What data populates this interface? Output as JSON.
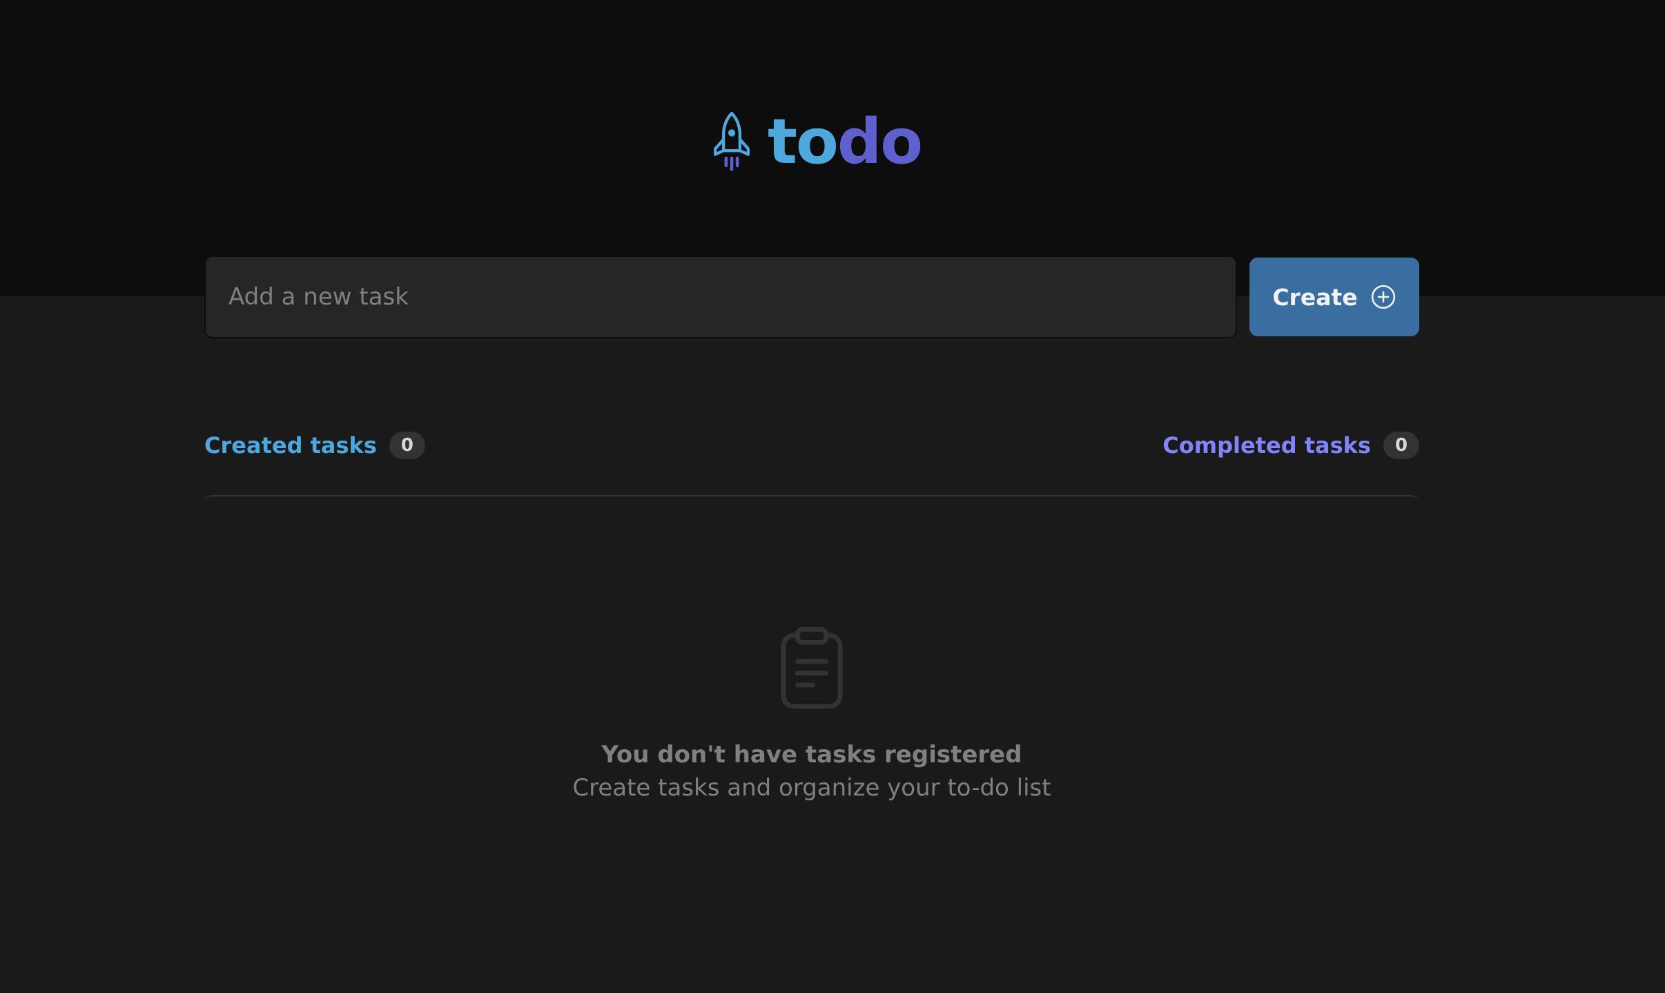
{
  "colors": {
    "header_bg": "#0d0d0d",
    "page_bg": "#1a1a1a",
    "input_bg": "#262626",
    "accent_blue": "#4ea8de",
    "accent_purple": "#5e60ce",
    "completed_purple": "#8284fa",
    "button_bg": "#3a6ea0",
    "muted_text": "#808080"
  },
  "header": {
    "logo_icon": "rocket-icon",
    "logo_part1": "to",
    "logo_part2": "do"
  },
  "new_task": {
    "placeholder": "Add a new task",
    "value": "",
    "button_label": "Create",
    "button_icon": "plus-circle-icon"
  },
  "counters": {
    "created": {
      "label": "Created tasks",
      "count": "0"
    },
    "completed": {
      "label": "Completed tasks",
      "count": "0"
    }
  },
  "empty_state": {
    "icon": "clipboard-icon",
    "title": "You don't have tasks registered",
    "subtitle": "Create tasks and organize your to-do list"
  }
}
